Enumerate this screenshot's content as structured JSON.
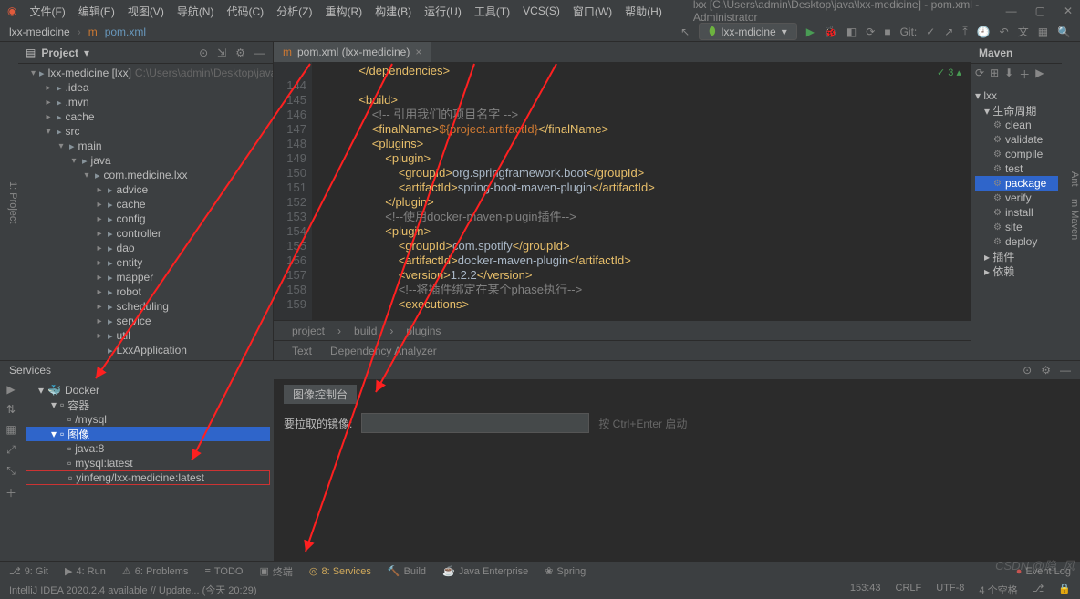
{
  "window": {
    "title": "lxx [C:\\Users\\admin\\Desktop\\java\\lxx-medicine] - pom.xml - Administrator"
  },
  "menu": [
    "文件(F)",
    "编辑(E)",
    "视图(V)",
    "导航(N)",
    "代码(C)",
    "分析(Z)",
    "重构(R)",
    "构建(B)",
    "运行(U)",
    "工具(T)",
    "VCS(S)",
    "窗口(W)",
    "帮助(H)"
  ],
  "breadcrumb": {
    "root": "lxx-medicine",
    "file": "pom.xml",
    "icon_label": "m"
  },
  "run_config": "lxx-mdicine",
  "toolbar_git": "Git:",
  "project_panel": {
    "title": "Project",
    "root": {
      "name": "lxx-medicine [lxx]",
      "path": "C:\\Users\\admin\\Desktop\\java\\lxx-me"
    },
    "rows": [
      {
        "indent": 1,
        "arrow": "▾",
        "label": "lxx-medicine [lxx]",
        "tail": "C:\\Users\\admin\\Desktop\\java\\lxx-me"
      },
      {
        "indent": 2,
        "arrow": "▸",
        "label": ".idea"
      },
      {
        "indent": 2,
        "arrow": "▸",
        "label": ".mvn"
      },
      {
        "indent": 2,
        "arrow": "▸",
        "label": "cache"
      },
      {
        "indent": 2,
        "arrow": "▾",
        "label": "src"
      },
      {
        "indent": 3,
        "arrow": "▾",
        "label": "main"
      },
      {
        "indent": 4,
        "arrow": "▾",
        "label": "java"
      },
      {
        "indent": 5,
        "arrow": "▾",
        "label": "com.medicine.lxx"
      },
      {
        "indent": 6,
        "arrow": "▸",
        "label": "advice"
      },
      {
        "indent": 6,
        "arrow": "▸",
        "label": "cache"
      },
      {
        "indent": 6,
        "arrow": "▸",
        "label": "config"
      },
      {
        "indent": 6,
        "arrow": "▸",
        "label": "controller"
      },
      {
        "indent": 6,
        "arrow": "▸",
        "label": "dao"
      },
      {
        "indent": 6,
        "arrow": "▸",
        "label": "entity"
      },
      {
        "indent": 6,
        "arrow": "▸",
        "label": "mapper"
      },
      {
        "indent": 6,
        "arrow": "▸",
        "label": "robot"
      },
      {
        "indent": 6,
        "arrow": "▸",
        "label": "scheduling"
      },
      {
        "indent": 6,
        "arrow": "▸",
        "label": "service"
      },
      {
        "indent": 6,
        "arrow": "▸",
        "label": "util"
      },
      {
        "indent": 6,
        "arrow": "",
        "label": "LxxApplication"
      }
    ]
  },
  "editor": {
    "tab_label": "pom.xml (lxx-medicine)",
    "validation": "✓ 3 ▴",
    "lines": [
      {
        "n": "",
        "html": "            <span class='tag'>&lt;/dependencies&gt;</span>"
      },
      {
        "n": "144",
        "html": ""
      },
      {
        "n": "145",
        "html": "            <span class='tag'>&lt;build&gt;</span>"
      },
      {
        "n": "146",
        "html": "                <span class='comment'>&lt;!-- 引用我们的项目名字 --&gt;</span>"
      },
      {
        "n": "147",
        "html": "                <span class='tag'>&lt;finalName&gt;</span><span class='var'>${project.artifactId}</span><span class='tag'>&lt;/finalName&gt;</span>"
      },
      {
        "n": "148",
        "html": "                <span class='tag'>&lt;plugins&gt;</span>"
      },
      {
        "n": "149",
        "html": "                    <span class='tag'>&lt;plugin&gt;</span>"
      },
      {
        "n": "150",
        "html": "                        <span class='tag'>&lt;groupId&gt;</span>org.springframework.boot<span class='tag'>&lt;/groupId&gt;</span>"
      },
      {
        "n": "151",
        "html": "                        <span class='tag'>&lt;artifactId&gt;</span>spring-boot-maven-plugin<span class='tag'>&lt;/artifactId&gt;</span>"
      },
      {
        "n": "152",
        "html": "                    <span class='tag'>&lt;/plugin&gt;</span>"
      },
      {
        "n": "153",
        "html": "                    <span class='comment'>&lt;!--使用docker-maven-plugin插件--&gt;</span>"
      },
      {
        "n": "154",
        "html": "                    <span class='tag'>&lt;plugin&gt;</span>"
      },
      {
        "n": "155",
        "html": "                        <span class='tag'>&lt;groupId&gt;</span>com.spotify<span class='tag'>&lt;/groupId&gt;</span>"
      },
      {
        "n": "156",
        "html": "                        <span class='tag'>&lt;artifactId&gt;</span>docker-maven-plugin<span class='tag'>&lt;/artifactId&gt;</span>"
      },
      {
        "n": "157",
        "html": "                        <span class='tag'>&lt;version&gt;</span>1.2.2<span class='tag'>&lt;/version&gt;</span>"
      },
      {
        "n": "158",
        "html": "                        <span class='comment'>&lt;!--将插件绑定在某个phase执行--&gt;</span>"
      },
      {
        "n": "159",
        "html": "                        <span class='tag'>&lt;executions&gt;</span>"
      }
    ],
    "crumb_path": [
      "project",
      "build",
      "plugins"
    ],
    "subtabs": [
      "Text",
      "Dependency Analyzer"
    ]
  },
  "maven": {
    "title": "Maven",
    "root": "lxx",
    "lifecycle_label": "生命周期",
    "goals": [
      "clean",
      "validate",
      "compile",
      "test",
      "package",
      "verify",
      "install",
      "site",
      "deploy"
    ],
    "selected": "package",
    "plugins_label": "插件",
    "deps_label": "依赖"
  },
  "services": {
    "title": "Services",
    "tree": [
      {
        "indent": 1,
        "arrow": "▾",
        "label": "Docker",
        "icon": "docker"
      },
      {
        "indent": 2,
        "arrow": "▾",
        "label": "容器"
      },
      {
        "indent": 3,
        "arrow": "",
        "label": "/mysql"
      },
      {
        "indent": 2,
        "arrow": "▾",
        "label": "图像",
        "selected": true
      },
      {
        "indent": 3,
        "arrow": "",
        "label": "java:8"
      },
      {
        "indent": 3,
        "arrow": "",
        "label": "mysql:latest"
      },
      {
        "indent": 3,
        "arrow": "",
        "label": "yinfeng/lxx-medicine:latest",
        "boxed": true
      }
    ],
    "right_tab": "图像控制台",
    "input_label": "要拉取的镜像:",
    "input_hint": "按 Ctrl+Enter 启动"
  },
  "bottom_bar": [
    "9: Git",
    "4: Run",
    "6: Problems",
    "TODO",
    "终端",
    "8: Services",
    "Build",
    "Java Enterprise",
    "Spring"
  ],
  "active_bottom": "8: Services",
  "event_log": "Event Log",
  "status": {
    "left": "IntelliJ IDEA 2020.2.4 available // Update... (今天 20:29)",
    "pos": "153:43",
    "eol": "CRLF",
    "enc": "UTF-8",
    "indent": "4 个空格"
  },
  "watermark": "CSDN @隐_风"
}
